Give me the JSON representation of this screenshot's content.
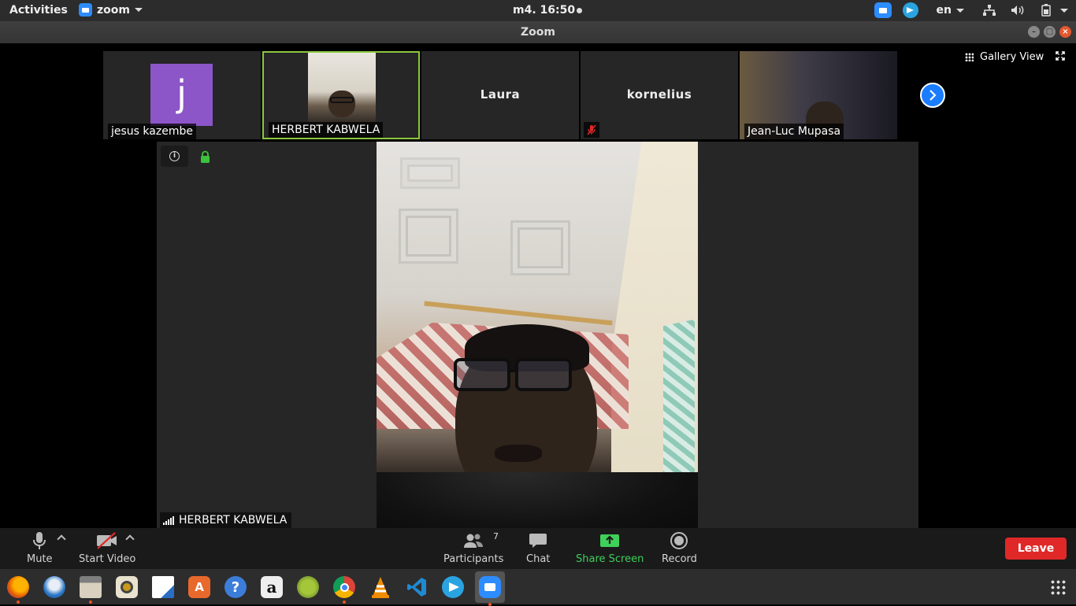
{
  "top_bar": {
    "activities_label": "Activities",
    "app_menu_label": "zoom",
    "clock": "m4. 16:50",
    "language": "en"
  },
  "window": {
    "title": "Zoom"
  },
  "gallery": {
    "tiles": [
      {
        "name": "jesus kazembe",
        "avatar_letter": "j",
        "avatar_color": "#8c56c8"
      },
      {
        "name": "HERBERT KABWELA",
        "active_speaker": true,
        "highlight_color": "#8dc63f"
      },
      {
        "name": "Laura"
      },
      {
        "name": "kornelius",
        "muted": true
      },
      {
        "name": "Jean-Luc Mupasa"
      }
    ],
    "view_mode_label": "Gallery View"
  },
  "main_video": {
    "speaker_name": "HERBERT KABWELA"
  },
  "controls": {
    "mute_label": "Mute",
    "start_video_label": "Start Video",
    "participants_label": "Participants",
    "participants_count": "7",
    "chat_label": "Chat",
    "share_screen_label": "Share Screen",
    "record_label": "Record",
    "leave_label": "Leave",
    "share_color": "#3fcf5b",
    "leave_color": "#e02828"
  },
  "dock": {
    "apps": [
      "firefox-icon",
      "thunderbird-icon",
      "files-icon",
      "rhythmbox-icon",
      "libreoffice-writer-icon",
      "software-center-icon",
      "help-icon",
      "amazon-icon",
      "android-studio-icon",
      "chrome-icon",
      "vlc-icon",
      "vscode-icon",
      "telegram-icon",
      "zoom-icon"
    ],
    "amazon_letter": "a",
    "help_glyph": "?"
  }
}
